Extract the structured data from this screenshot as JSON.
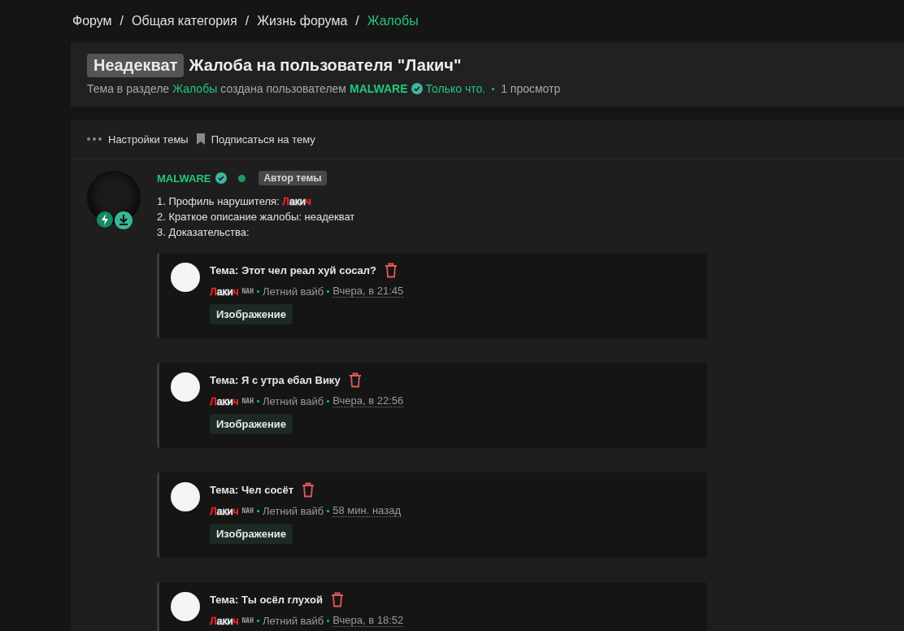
{
  "breadcrumbs": [
    {
      "label": "Форум",
      "current": false
    },
    {
      "separator": "/",
      "label": "Общая категория",
      "current": false
    },
    {
      "separator": "/",
      "label": "Жизнь форума",
      "current": false
    },
    {
      "separator": "/",
      "label": "Жалобы",
      "current": true
    }
  ],
  "thread": {
    "prefix": "Неадекват",
    "title": "Жалоба на пользователя \"Лакич\"",
    "meta_before": "Тема в разделе",
    "section": "Жалобы",
    "meta_mid": "создана пользователем",
    "author": "MALWARE",
    "verified": true,
    "time": "Только что.",
    "views": "1 просмотр"
  },
  "toolbar": [
    {
      "kind": "menu",
      "label": "Настройки темы"
    },
    {
      "kind": "bookmark",
      "label": "Подписаться на тему"
    }
  ],
  "post": {
    "author": "MALWARE",
    "verified": true,
    "online": true,
    "author_badge": "Автор темы",
    "lines": [
      {
        "text": "1. Профиль нарушителя: ",
        "name_parts": [
          {
            "text": "Л",
            "color": "#ff2424"
          },
          {
            "text": "аки",
            "color": "#e6e6e6"
          },
          {
            "text": "ч",
            "color": "#ff2424"
          }
        ]
      },
      {
        "text": "2. Краткое описание жалобы: неадекват"
      },
      {
        "text": "3. Доказательства:"
      }
    ],
    "quotes": [
      {
        "title": "Тема: Этот чел реал хуй сосал?",
        "name_parts": [
          {
            "text": "Л",
            "color": "#ff2424"
          },
          {
            "text": "аки",
            "color": "#e6e6e6"
          },
          {
            "text": "ч",
            "color": "#ff2424"
          }
        ],
        "tag": "NAH",
        "group": "Летний вайб",
        "time": "Вчера, в 21:45",
        "attachment": "Изображение"
      },
      {
        "title": "Тема: Я с утра ебал Вику",
        "name_parts": [
          {
            "text": "Л",
            "color": "#ff2424"
          },
          {
            "text": "аки",
            "color": "#e6e6e6"
          },
          {
            "text": "ч",
            "color": "#ff2424"
          }
        ],
        "tag": "NAH",
        "group": "Летний вайб",
        "time": "Вчера, в 22:56",
        "attachment": "Изображение"
      },
      {
        "title": "Тема: Чел сосёт",
        "name_parts": [
          {
            "text": "Л",
            "color": "#ff2424"
          },
          {
            "text": "аки",
            "color": "#e6e6e6"
          },
          {
            "text": "ч",
            "color": "#ff2424"
          }
        ],
        "tag": "NAH",
        "group": "Летний вайб",
        "time": "58 мин. назад",
        "attachment": "Изображение"
      },
      {
        "title": "Тема: Ты осёл глухой",
        "name_parts": [
          {
            "text": "Л",
            "color": "#ff2424"
          },
          {
            "text": "аки",
            "color": "#e6e6e6"
          },
          {
            "text": "ч",
            "color": "#ff2424"
          }
        ],
        "tag": "NAH",
        "group": "Летний вайб",
        "time": "Вчера, в 18:52"
      }
    ]
  }
}
